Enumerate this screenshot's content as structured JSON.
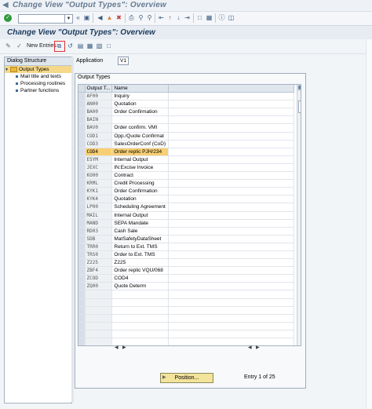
{
  "window": {
    "title": "Change View \"Output Types\": Overview"
  },
  "page": {
    "heading": "Change View \"Output Types\": Overview"
  },
  "toolbar": {
    "new_entries_label": "New Entries"
  },
  "dialog_structure": {
    "header": "Dialog Structure",
    "items": [
      {
        "label": "Output Types",
        "selected": true,
        "level": 0
      },
      {
        "label": "Mail title and texts",
        "level": 1
      },
      {
        "label": "Processing routines",
        "level": 1
      },
      {
        "label": "Partner functions",
        "level": 1
      }
    ]
  },
  "application": {
    "label": "Application",
    "value": "V1"
  },
  "output_types": {
    "frame_title": "Output Types",
    "columns": [
      "Output T...",
      "Name"
    ],
    "rows": [
      {
        "code": "AF00",
        "name": "Inquiry"
      },
      {
        "code": "AN00",
        "name": "Quotation"
      },
      {
        "code": "BA00",
        "name": "Order Confirmation"
      },
      {
        "code": "BAIN",
        "name": ""
      },
      {
        "code": "BAV0",
        "name": "Order confirm.  VMI"
      },
      {
        "code": "COD1",
        "name": "Opp./Quote Confirmat"
      },
      {
        "code": "COD3",
        "name": "SalesOrderConf (CoD)"
      },
      {
        "code": "COD4",
        "name": "Order replic PJH/234",
        "highlight": true
      },
      {
        "code": "ESYM",
        "name": "Internal Output"
      },
      {
        "code": "JEXC",
        "name": "IN:Excise Invoice"
      },
      {
        "code": "KO00",
        "name": "Contract"
      },
      {
        "code": "KRML",
        "name": "Credit Processing"
      },
      {
        "code": "KYK1",
        "name": "Order Confirmation"
      },
      {
        "code": "KYK4",
        "name": "Quotation"
      },
      {
        "code": "LP00",
        "name": "Scheduling Agreement"
      },
      {
        "code": "MAIL",
        "name": "Internal Output"
      },
      {
        "code": "MAND",
        "name": "SEPA Mandate"
      },
      {
        "code": "RD03",
        "name": "Cash Sale"
      },
      {
        "code": "SDB",
        "name": "MatSafetyDataSheet"
      },
      {
        "code": "TRR0",
        "name": "Return to Ext. TMS"
      },
      {
        "code": "TRS0",
        "name": "Order to Ext. TMS"
      },
      {
        "code": "Z225",
        "name": "Z225"
      },
      {
        "code": "ZBF4",
        "name": "Order replic VQU/068"
      },
      {
        "code": "ZCOD",
        "name": "COD4"
      },
      {
        "code": "ZQ00",
        "name": "Quote Determ"
      }
    ],
    "empty_rows": 7
  },
  "footer": {
    "position_button": "Position...",
    "entry_text": "Entry 1 of 25"
  }
}
